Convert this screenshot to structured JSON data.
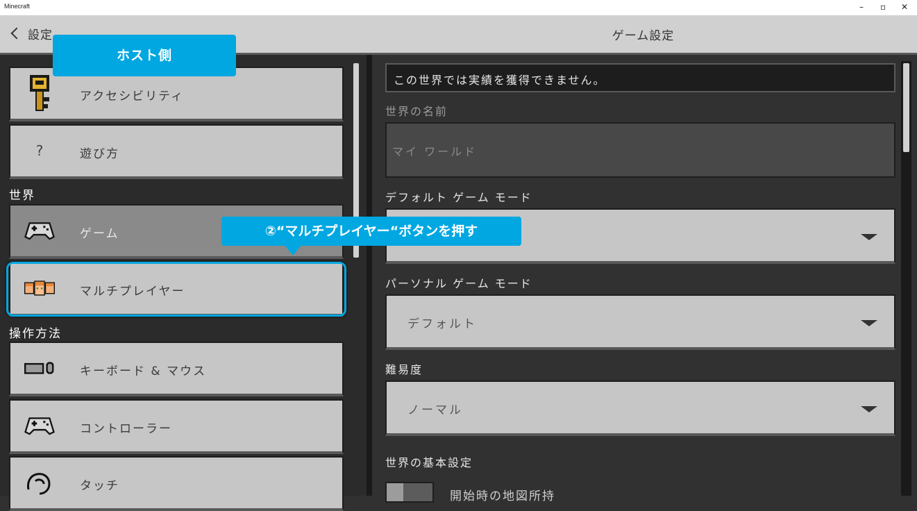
{
  "window": {
    "app_title": "Minecraft",
    "minimize": "–",
    "restore": "▫",
    "close": "✕"
  },
  "header": {
    "back_label": "設定",
    "title": "ゲーム設定"
  },
  "sidebar": {
    "items_top": [
      {
        "label": "アクセシビリティ",
        "icon": "key-icon"
      },
      {
        "label": "遊び方",
        "icon": "question-icon"
      }
    ],
    "section_world": "世界",
    "items_world": [
      {
        "label": "ゲーム",
        "icon": "controller-icon",
        "active": true
      },
      {
        "label": "マルチプレイヤー",
        "icon": "multiplayer-faces-icon",
        "highlighted": true
      }
    ],
    "section_controls": "操作方法",
    "items_controls": [
      {
        "label": "キーボード & マウス",
        "icon": "keyboard-mouse-icon"
      },
      {
        "label": "コントローラー",
        "icon": "controller-icon"
      },
      {
        "label": "タッチ",
        "icon": "touch-hand-icon"
      }
    ]
  },
  "main": {
    "notice": "この世界では実績を獲得できません。",
    "world_name_label": "世界の名前",
    "world_name_placeholder": "マイ ワールド",
    "default_game_mode_label": "デフォルト ゲーム モード",
    "default_game_mode_value": "",
    "personal_game_mode_label": "パーソナル ゲーム モード",
    "personal_game_mode_value": "デフォルト",
    "difficulty_label": "難易度",
    "difficulty_value": "ノーマル",
    "world_basics_label": "世界の基本設定",
    "starting_map_label": "開始時の地図所持"
  },
  "annotations": {
    "host_side": "ホスト側",
    "step2": "②“マルチプレイヤー“ボタンを押す",
    "accent_color": "#00a7e1"
  }
}
